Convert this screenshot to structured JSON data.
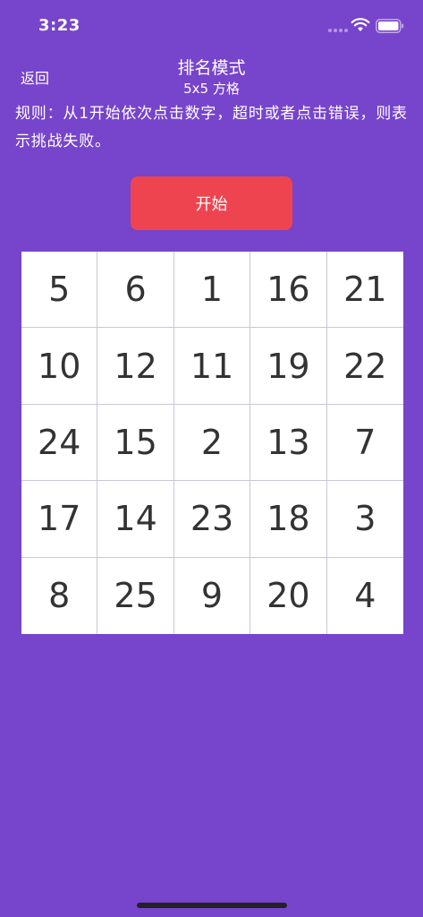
{
  "status_bar": {
    "time": "3:23"
  },
  "nav": {
    "back_label": "返回",
    "title": "排名模式",
    "subtitle": "5x5 方格"
  },
  "rules": {
    "text": "规则：从1开始依次点击数字，超时或者点击错误，则表示挑战失败。"
  },
  "start_button": {
    "label": "开始",
    "color": "#ee4450"
  },
  "grid": {
    "rows": 5,
    "cols": 5,
    "cells": [
      "5",
      "6",
      "1",
      "16",
      "21",
      "10",
      "12",
      "11",
      "19",
      "22",
      "24",
      "15",
      "2",
      "13",
      "7",
      "17",
      "14",
      "23",
      "18",
      "3",
      "8",
      "25",
      "9",
      "20",
      "4"
    ]
  },
  "colors": {
    "background": "#7744cc",
    "cell_background": "#ffffff",
    "cell_text": "#333333"
  }
}
